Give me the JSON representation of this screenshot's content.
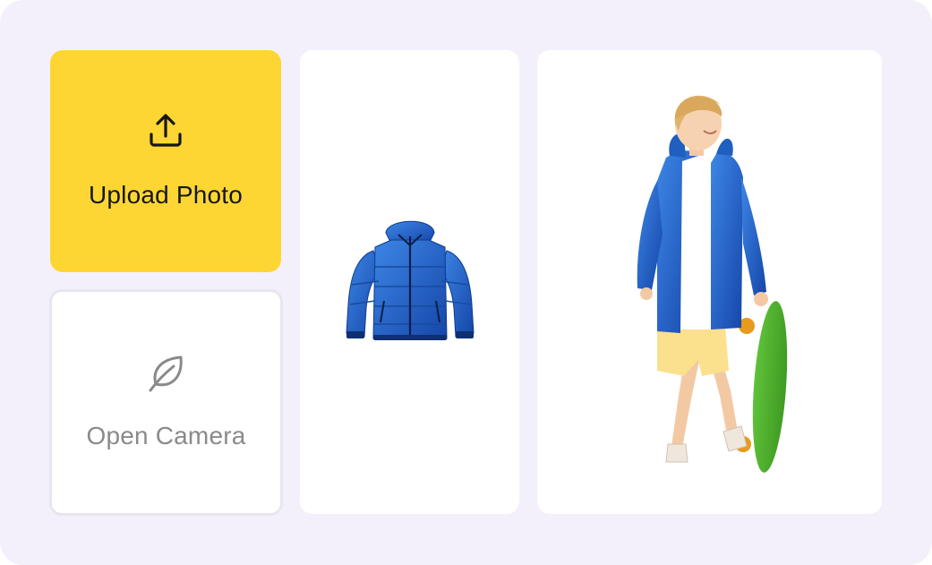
{
  "upload": {
    "label": "Upload Photo",
    "icon": "upload-icon",
    "background": "#fed634"
  },
  "camera": {
    "label": "Open Camera",
    "icon": "leaf-icon",
    "label_color": "#8a8a8a"
  },
  "product": {
    "icon": "puffer-jacket-image",
    "color": "#1f63c8"
  },
  "model": {
    "icon": "child-with-skateboard-image"
  },
  "colors": {
    "page_background": "#f3f0fc",
    "card_background": "#ffffff"
  }
}
